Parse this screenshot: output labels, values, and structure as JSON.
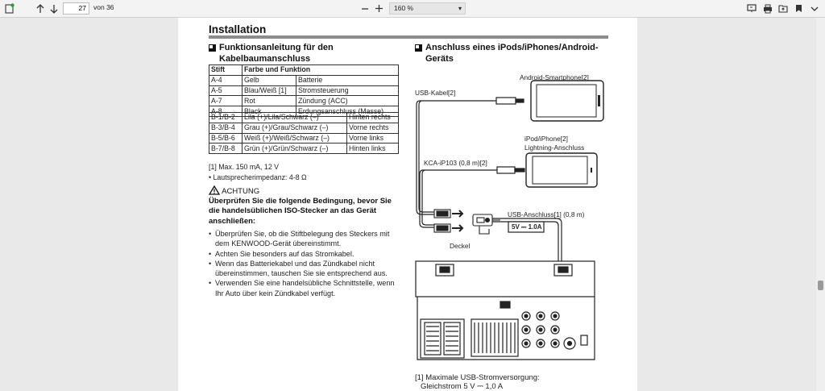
{
  "toolbar": {
    "page_number": "27",
    "of_pages": "von 36",
    "zoom": "160 %"
  },
  "document": {
    "title": "Installation",
    "left_section_title": "Funktionsanleitung für den Kabelbaumanschluss",
    "left_section_line1": "Funktionsanleitung für den",
    "left_section_line2": "Kabelbaumanschluss",
    "table": {
      "header": [
        "Stift",
        "Farbe und Funktion"
      ],
      "rows": [
        [
          "A-4",
          "Gelb",
          "Batterie"
        ],
        [
          "A-5",
          "Blau/Weiß [1]",
          "Stromsteuerung"
        ],
        [
          "A-7",
          "Rot",
          "Zündung (ACC)"
        ],
        [
          "A-8",
          "Black",
          "Erdungsanschluss (Masse)"
        ],
        [
          "B-1/B-2",
          "Lila (+)/Lila/Schwarz (–)",
          "Hinten rechts"
        ],
        [
          "B-3/B-4",
          "Grau (+)/Grau/Schwarz (–)",
          "Vorne rechts"
        ],
        [
          "B-5/B-6",
          "Weiß (+)/Weiß/Schwarz (–)",
          "Vorne links"
        ],
        [
          "B-7/B-8",
          "Grün (+)/Grün/Schwarz (–)",
          "Hinten links"
        ]
      ]
    },
    "footnote_1": "[1] Max. 150 mA, 12 V",
    "impedance": "• Lautsprecherimpedanz: 4-8 Ω",
    "warning_label": "ACHTUNG",
    "warning_bold": "Überprüfen Sie die folgende Bedingung, bevor Sie die handelsüblichen ISO-Stecker an das Gerät anschließen:",
    "bullets": [
      "Überprüfen Sie, ob die Stiftbelegung des Steckers mit dem KENWOOD-Gerät übereinstimmt.",
      "Achten Sie besonders auf das Stromkabel.",
      "Wenn das Batteriekabel und das Zündkabel nicht übereinstimmen, tauschen Sie sie entsprechend aus.",
      "Verwenden Sie eine handelsübliche Schnittstelle, wenn Ihr Auto über kein Zündkabel verfügt."
    ],
    "right_section_line1": "Anschluss eines iPods/iPhones/Android-",
    "right_section_line2": "Geräts",
    "diagram": {
      "android_label": "Android-Smartphone[2]",
      "usb_cable_label": "USB-Kabel[2]",
      "iphone_label_1": "iPod/iPhone[2]",
      "iphone_label_2": "Lightning-Anschluss",
      "kca_label": "KCA-iP103 (0,8 m)[2]",
      "usb_port_label": "USB-Anschluss[1] (0,8 m)",
      "rating_label": "5V ⎓ 1.0A",
      "cover_label": "Deckel"
    },
    "footnote_right_1": "[1] Maximale USB-Stromversorgung:",
    "footnote_right_2": "Gleichstrom 5 V ⎓ 1,0 A"
  }
}
